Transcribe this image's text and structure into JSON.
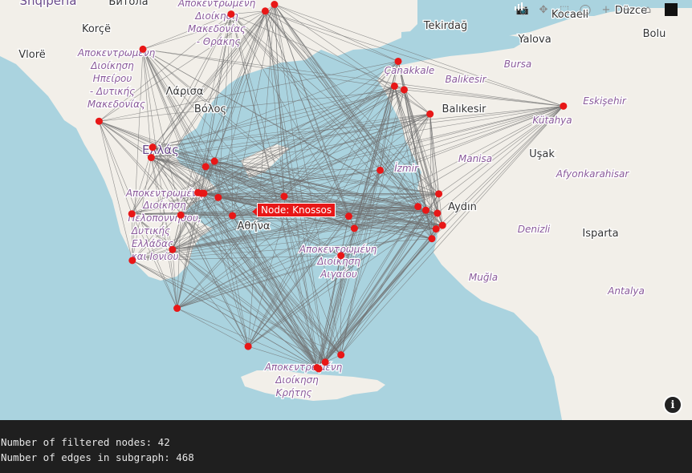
{
  "map": {
    "labels": [
      {
        "text": "Shqipëria",
        "kind": "country"
      },
      {
        "text": "Битола",
        "kind": "city"
      },
      {
        "text": "Korçë",
        "kind": "city"
      },
      {
        "text": "Vlorë",
        "kind": "city"
      },
      {
        "text": "Αποκεντρωμένη",
        "kind": "region"
      },
      {
        "text": "Διοίκηση",
        "kind": "region"
      },
      {
        "text": "Μακεδονίας",
        "kind": "region"
      },
      {
        "text": "- Θράκης",
        "kind": "region"
      },
      {
        "text": "Αποκεντρωμένη",
        "kind": "region"
      },
      {
        "text": "Διοίκηση",
        "kind": "region"
      },
      {
        "text": "Ηπείρου",
        "kind": "region"
      },
      {
        "text": "- Δυτικής",
        "kind": "region"
      },
      {
        "text": "Μακεδονίας",
        "kind": "region"
      },
      {
        "text": "Λάρισα",
        "kind": "city"
      },
      {
        "text": "Βόλος",
        "kind": "city"
      },
      {
        "text": "Ελλάς",
        "kind": "country"
      },
      {
        "text": "Αποκεντρωμένη",
        "kind": "region"
      },
      {
        "text": "Διοίκηση",
        "kind": "region"
      },
      {
        "text": "Πελοποννήσου,",
        "kind": "region"
      },
      {
        "text": "Δυτικής",
        "kind": "region"
      },
      {
        "text": "Ελλάδας",
        "kind": "region"
      },
      {
        "text": "και Ιονίου",
        "kind": "region"
      },
      {
        "text": "Αθήνα",
        "kind": "city"
      },
      {
        "text": "Αποκεντρωμένη",
        "kind": "region"
      },
      {
        "text": "Διοίκηση",
        "kind": "region"
      },
      {
        "text": "Αιγαίου",
        "kind": "region"
      },
      {
        "text": "Αποκεντρωμένη",
        "kind": "region"
      },
      {
        "text": "Διοίκηση",
        "kind": "region"
      },
      {
        "text": "Κρήτης",
        "kind": "region"
      },
      {
        "text": "Tekirdağ",
        "kind": "city"
      },
      {
        "text": "Kocaeli",
        "kind": "city"
      },
      {
        "text": "Düzce",
        "kind": "city"
      },
      {
        "text": "Bolu",
        "kind": "city"
      },
      {
        "text": "Yalova",
        "kind": "city"
      },
      {
        "text": "Bursa",
        "kind": "region"
      },
      {
        "text": "Çanakkale",
        "kind": "region"
      },
      {
        "text": "Balıkesir",
        "kind": "region"
      },
      {
        "text": "Balıkesir",
        "kind": "city"
      },
      {
        "text": "Eskişehir",
        "kind": "region"
      },
      {
        "text": "Kütahya",
        "kind": "region"
      },
      {
        "text": "Uşak",
        "kind": "city"
      },
      {
        "text": "Manisa",
        "kind": "region"
      },
      {
        "text": "İzmir",
        "kind": "region"
      },
      {
        "text": "Afyonkarahisar",
        "kind": "region"
      },
      {
        "text": "Aydın",
        "kind": "city"
      },
      {
        "text": "Isparta",
        "kind": "city"
      },
      {
        "text": "Denizli",
        "kind": "region"
      },
      {
        "text": "Muğla",
        "kind": "region"
      },
      {
        "text": "Antalya",
        "kind": "region"
      }
    ],
    "tooltip": "Node: Knossos",
    "node_color": "#e81717",
    "edge_color": "#707070",
    "water_color": "#aad3df",
    "land_color": "#f2efe9",
    "nodes": [
      {
        "lon": 22.78,
        "lat": 40.93
      },
      {
        "lon": 23.72,
        "lat": 41.09
      },
      {
        "lon": 23.52,
        "lat": 40.98
      },
      {
        "lon": 20.87,
        "lat": 40.35
      },
      {
        "lon": 26.4,
        "lat": 40.15
      },
      {
        "lon": 26.32,
        "lat": 39.74
      },
      {
        "lon": 26.53,
        "lat": 39.68
      },
      {
        "lon": 27.09,
        "lat": 39.28
      },
      {
        "lon": 29.98,
        "lat": 39.41
      },
      {
        "lon": 19.92,
        "lat": 39.16
      },
      {
        "lon": 21.08,
        "lat": 38.73
      },
      {
        "lon": 21.05,
        "lat": 38.56
      },
      {
        "lon": 22.23,
        "lat": 38.41
      },
      {
        "lon": 22.42,
        "lat": 38.5
      },
      {
        "lon": 26.01,
        "lat": 38.35
      },
      {
        "lon": 27.28,
        "lat": 37.96
      },
      {
        "lon": 22.06,
        "lat": 37.98
      },
      {
        "lon": 22.14,
        "lat": 37.97
      },
      {
        "lon": 22.19,
        "lat": 37.97
      },
      {
        "lon": 26.83,
        "lat": 37.75
      },
      {
        "lon": 27.0,
        "lat": 37.69
      },
      {
        "lon": 27.25,
        "lat": 37.64
      },
      {
        "lon": 20.63,
        "lat": 37.63
      },
      {
        "lon": 21.69,
        "lat": 37.61
      },
      {
        "lon": 22.81,
        "lat": 37.6
      },
      {
        "lon": 25.33,
        "lat": 37.59
      },
      {
        "lon": 25.45,
        "lat": 37.39
      },
      {
        "lon": 27.36,
        "lat": 37.44
      },
      {
        "lon": 27.22,
        "lat": 37.38
      },
      {
        "lon": 27.13,
        "lat": 37.22
      },
      {
        "lon": 21.51,
        "lat": 37.04
      },
      {
        "lon": 20.64,
        "lat": 36.86
      },
      {
        "lon": 25.16,
        "lat": 36.94
      },
      {
        "lon": 21.61,
        "lat": 36.07
      },
      {
        "lon": 23.15,
        "lat": 35.44
      },
      {
        "lon": 25.16,
        "lat": 35.3
      },
      {
        "lon": 24.82,
        "lat": 35.18
      },
      {
        "lon": 24.64,
        "lat": 35.09
      },
      {
        "lon": 24.68,
        "lat": 35.07
      },
      {
        "lon": 23.93,
        "lat": 37.92
      },
      {
        "lon": 23.95,
        "lat": 37.64
      },
      {
        "lon": 22.5,
        "lat": 37.9
      }
    ]
  },
  "toolbar": {
    "buttons": [
      {
        "name": "camera-button",
        "icon": "📷"
      },
      {
        "name": "pan-button",
        "icon": "✥"
      },
      {
        "name": "box-select-button",
        "icon": "⬚"
      },
      {
        "name": "lasso-select-button",
        "icon": "◯"
      },
      {
        "name": "zoom-in-button",
        "icon": "+"
      },
      {
        "name": "zoom-out-button",
        "icon": "−"
      },
      {
        "name": "reset-view-button",
        "icon": "⌂"
      }
    ]
  },
  "info_button": {
    "icon": "i"
  },
  "output": {
    "line1": "Number of filtered nodes: 42",
    "line2": "Number of edges in subgraph: 468"
  }
}
